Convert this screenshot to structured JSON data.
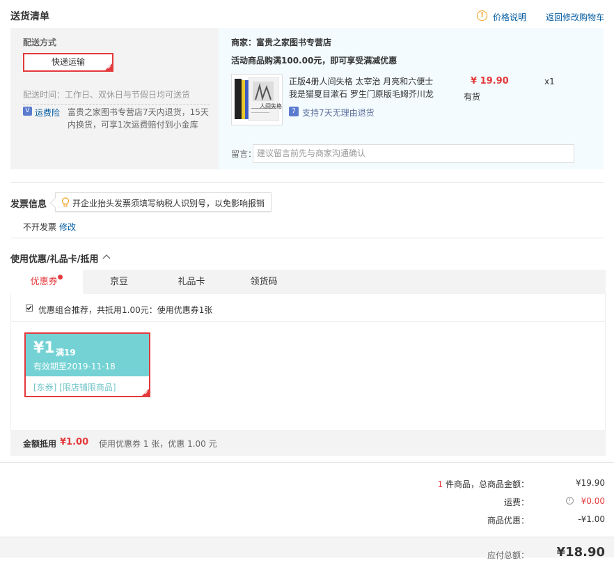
{
  "header": {
    "title": "送货清单",
    "price_note": "价格说明",
    "back_to_cart": "返回修改购物车"
  },
  "shipping": {
    "label": "配送方式",
    "method": "快递运输",
    "time": "配送时间：工作日、双休日与节假日均可送货",
    "insurance_label": "运费险",
    "insurance_text_1": "富贵之家图书专营店7天内退货，15天",
    "insurance_text_2": "内换货，可享1次运费赔付到小金库"
  },
  "shop": {
    "name": "商家：富贵之家图书专营店",
    "promo": "活动商品购满100.00元，即可享受满减优惠",
    "product_title_1": "正版4册人间失格 太宰治 月亮和六便士",
    "product_title_2": "我是猫夏目漱石 罗生门原版毛姆芥川龙",
    "price": "¥ 19.90",
    "stock": "有货",
    "quantity": "x1",
    "return_policy": "支持7天无理由退货",
    "book_cover_text": "人间失格",
    "remark_label": "留言：",
    "remark_placeholder": "建议留言前先与商家沟通确认"
  },
  "invoice": {
    "title": "发票信息",
    "tip": "开企业抬头发票须填写纳税人识别号，以免影响报销",
    "status": "不开发票",
    "edit": "修改"
  },
  "discount": {
    "title": "使用优惠/礼品卡/抵用",
    "tabs": [
      "优惠券",
      "京豆",
      "礼品卡",
      "领货码"
    ],
    "combo_text": "优惠组合推荐，共抵用1.00元：使用优惠券1张",
    "coupon": {
      "amount": "¥1",
      "condition": "满19",
      "expiry": "有效期至2019-11-18",
      "tags": "[东券] [限店铺限商品]"
    },
    "summary_label": "金额抵用",
    "summary_amount": "¥1.00",
    "summary_detail": "使用优惠券 1 张，优惠 1.00 元"
  },
  "totals": {
    "items_count": "1",
    "items_label": "件商品，总商品金额：",
    "items_amount": "¥19.90",
    "shipping_label": "运费：",
    "shipping_amount": "¥0.00",
    "discount_label": "商品优惠：",
    "discount_amount": "-¥1.00",
    "payable_label": "应付总额：",
    "payable_amount": "¥18.90"
  },
  "colors": {
    "accent_red": "#e4393c",
    "link_blue": "#005aa0",
    "coupon_teal": "#74d2d4",
    "warn_orange": "#f0a020"
  }
}
